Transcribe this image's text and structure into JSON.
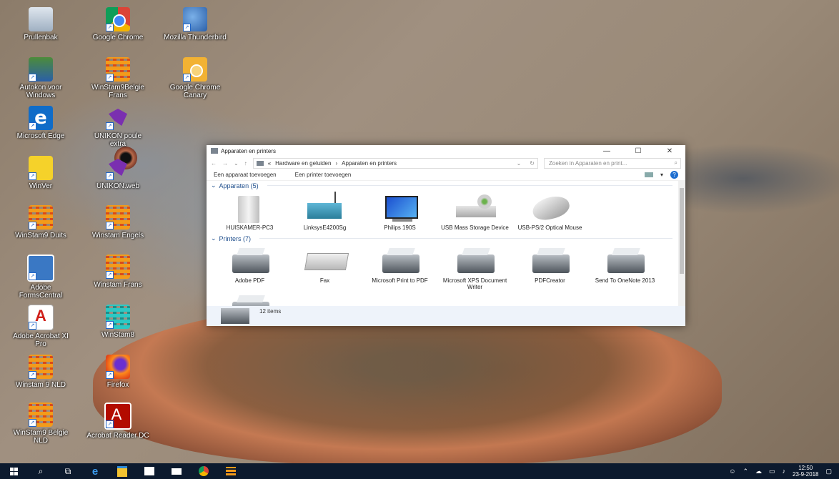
{
  "desktop": {
    "icons": [
      {
        "label": "Prullenbak",
        "icon": "recycle-bin-icon"
      },
      {
        "label": "Google Chrome",
        "icon": "chrome-icon"
      },
      {
        "label": "Mozilla Thunderbird",
        "icon": "thunderbird-icon"
      },
      {
        "label": "Autokon voor Windows",
        "icon": "autokon-icon"
      },
      {
        "label": "WinStam9Belgie Frans",
        "icon": "winstam-icon"
      },
      {
        "label": "Google Chrome Canary",
        "icon": "chrome-canary-icon"
      },
      {
        "label": "Microsoft Edge",
        "icon": "edge-icon"
      },
      {
        "label": "UNIKON poule extra",
        "icon": "unikon-icon"
      },
      {
        "label": "WinVer",
        "icon": "winver-icon"
      },
      {
        "label": "UNIKON.web",
        "icon": "unikon-web-icon"
      },
      {
        "label": "WinStam9 Duits",
        "icon": "winstam-icon"
      },
      {
        "label": "Winstam Engels",
        "icon": "winstam-icon"
      },
      {
        "label": "Adobe FormsCentral",
        "icon": "forms-central-icon"
      },
      {
        "label": "Winstam Frans",
        "icon": "winstam-icon"
      },
      {
        "label": "Adobe Acrobat XI Pro",
        "icon": "acrobat-icon"
      },
      {
        "label": "WinStam8",
        "icon": "winstam8-icon"
      },
      {
        "label": "Winstam 9 NLD",
        "icon": "winstam-icon"
      },
      {
        "label": "Firefox",
        "icon": "firefox-icon"
      },
      {
        "label": "WinStam9 Belgie NLD",
        "icon": "winstam-icon"
      },
      {
        "label": "Acrobat Reader DC",
        "icon": "acrobat-reader-icon"
      }
    ]
  },
  "explorer": {
    "title": "Apparaten en printers",
    "address": [
      "Hardware en geluiden",
      "Apparaten en printers"
    ],
    "address_prefix": "«",
    "address_sep": "›",
    "search_placeholder": "Zoeken in Apparaten en print...",
    "commands": [
      "Een apparaat toevoegen",
      "Een printer toevoegen"
    ],
    "groups": [
      {
        "title": "Apparaten (5)",
        "items": [
          {
            "name": "HUISKAMER-PC3",
            "icon": "computer-icon"
          },
          {
            "name": "LinksysE4200Sg",
            "icon": "router-icon"
          },
          {
            "name": "Philips 190S",
            "icon": "monitor-icon"
          },
          {
            "name": "USB Mass Storage Device",
            "icon": "usb-drive-icon"
          },
          {
            "name": "USB-PS/2 Optical Mouse",
            "icon": "mouse-icon"
          }
        ]
      },
      {
        "title": "Printers (7)",
        "items": [
          {
            "name": "Adobe PDF",
            "icon": "printer-icon"
          },
          {
            "name": "Fax",
            "icon": "fax-icon"
          },
          {
            "name": "Microsoft Print to PDF",
            "icon": "printer-icon"
          },
          {
            "name": "Microsoft XPS Document Writer",
            "icon": "printer-icon"
          },
          {
            "name": "PDFCreator",
            "icon": "printer-icon"
          },
          {
            "name": "Send To OneNote 2013",
            "icon": "printer-icon"
          }
        ]
      }
    ],
    "status_count": "12 items"
  },
  "taskbar": {
    "time": "12:50",
    "date": "23-9-2018"
  }
}
